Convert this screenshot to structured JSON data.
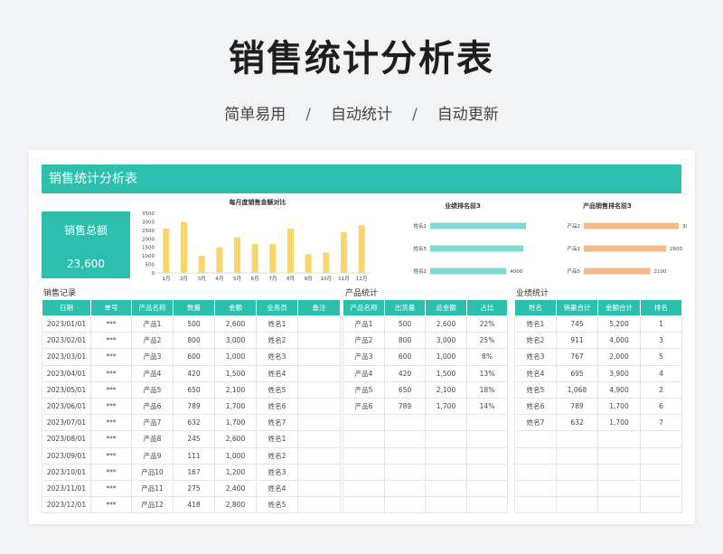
{
  "hero": {
    "title": "销售统计分析表",
    "subtitle_parts": [
      "简单易用",
      "自动统计",
      "自动更新"
    ],
    "separator": "/"
  },
  "sheet": {
    "banner": "销售统计分析表",
    "total": {
      "label": "销售总额",
      "value": "23,600"
    }
  },
  "colors": {
    "accent": "#2dbfad",
    "bar_yellow": "#f9d56e",
    "bar_teal": "#7fd9d1",
    "bar_orange": "#f3b98a"
  },
  "chart_data": [
    {
      "type": "bar",
      "title": "每月度销售金额对比",
      "categories": [
        "1月",
        "2月",
        "3月",
        "4月",
        "5月",
        "6月",
        "7月",
        "8月",
        "9月",
        "10月",
        "11月",
        "12月"
      ],
      "values": [
        2600,
        3000,
        1000,
        1500,
        2100,
        1700,
        1700,
        2600,
        1100,
        1200,
        2400,
        2800
      ],
      "ylim": [
        0,
        3500
      ],
      "yticks": [
        0,
        500,
        1000,
        1500,
        2000,
        2500,
        3000,
        3500
      ],
      "color": "#f9d56e"
    },
    {
      "type": "bar",
      "orientation": "horizontal",
      "title": "业绩排名前3",
      "categories": [
        "姓名1",
        "姓名5",
        "姓名2"
      ],
      "values": [
        5200,
        4900,
        4000
      ],
      "xlim": [
        0,
        5600
      ],
      "color": "#7fd9d1"
    },
    {
      "type": "bar",
      "orientation": "horizontal",
      "title": "产品销售排名前3",
      "categories": [
        "产品2",
        "产品1",
        "产品5"
      ],
      "values": [
        3000,
        2600,
        2100
      ],
      "xlim": [
        0,
        3200
      ],
      "color": "#f3b98a"
    }
  ],
  "sales": {
    "title": "销售记录",
    "headers": [
      "日期",
      "单号",
      "产品名称",
      "数量",
      "金额",
      "业务员",
      "备注"
    ],
    "rows": [
      [
        "2023/01/01",
        "***",
        "产品1",
        "500",
        "2,600",
        "姓名1",
        ""
      ],
      [
        "2023/02/01",
        "***",
        "产品2",
        "800",
        "3,000",
        "姓名2",
        ""
      ],
      [
        "2023/03/01",
        "***",
        "产品3",
        "600",
        "1,000",
        "姓名3",
        ""
      ],
      [
        "2023/04/01",
        "***",
        "产品4",
        "420",
        "1,500",
        "姓名4",
        ""
      ],
      [
        "2023/05/01",
        "***",
        "产品5",
        "650",
        "2,100",
        "姓名5",
        ""
      ],
      [
        "2023/06/01",
        "***",
        "产品6",
        "789",
        "1,700",
        "姓名6",
        ""
      ],
      [
        "2023/07/01",
        "***",
        "产品7",
        "632",
        "1,700",
        "姓名7",
        ""
      ],
      [
        "2023/08/01",
        "***",
        "产品8",
        "245",
        "2,600",
        "姓名1",
        ""
      ],
      [
        "2023/09/01",
        "***",
        "产品9",
        "111",
        "1,000",
        "姓名2",
        ""
      ],
      [
        "2023/10/01",
        "***",
        "产品10",
        "167",
        "1,200",
        "姓名3",
        ""
      ],
      [
        "2023/11/01",
        "***",
        "产品11",
        "275",
        "2,400",
        "姓名4",
        ""
      ],
      [
        "2023/12/01",
        "***",
        "产品12",
        "418",
        "2,800",
        "姓名5",
        ""
      ]
    ]
  },
  "products": {
    "title": "产品统计",
    "headers": [
      "产品名称",
      "出货量",
      "总金额",
      "占比"
    ],
    "rows": [
      [
        "产品1",
        "500",
        "2,600",
        "22%"
      ],
      [
        "产品2",
        "800",
        "3,000",
        "25%"
      ],
      [
        "产品3",
        "600",
        "1,000",
        "8%"
      ],
      [
        "产品4",
        "420",
        "1,500",
        "13%"
      ],
      [
        "产品5",
        "650",
        "2,100",
        "18%"
      ],
      [
        "产品6",
        "789",
        "1,700",
        "14%"
      ]
    ]
  },
  "performance": {
    "title": "业绩统计",
    "headers": [
      "姓名",
      "销量合计",
      "金额合计",
      "排名"
    ],
    "rows": [
      [
        "姓名1",
        "745",
        "5,200",
        "1"
      ],
      [
        "姓名2",
        "911",
        "4,000",
        "3"
      ],
      [
        "姓名3",
        "767",
        "2,000",
        "5"
      ],
      [
        "姓名4",
        "695",
        "3,900",
        "4"
      ],
      [
        "姓名5",
        "1,068",
        "4,900",
        "2"
      ],
      [
        "姓名6",
        "789",
        "1,700",
        "6"
      ],
      [
        "姓名7",
        "632",
        "1,700",
        "7"
      ]
    ]
  }
}
